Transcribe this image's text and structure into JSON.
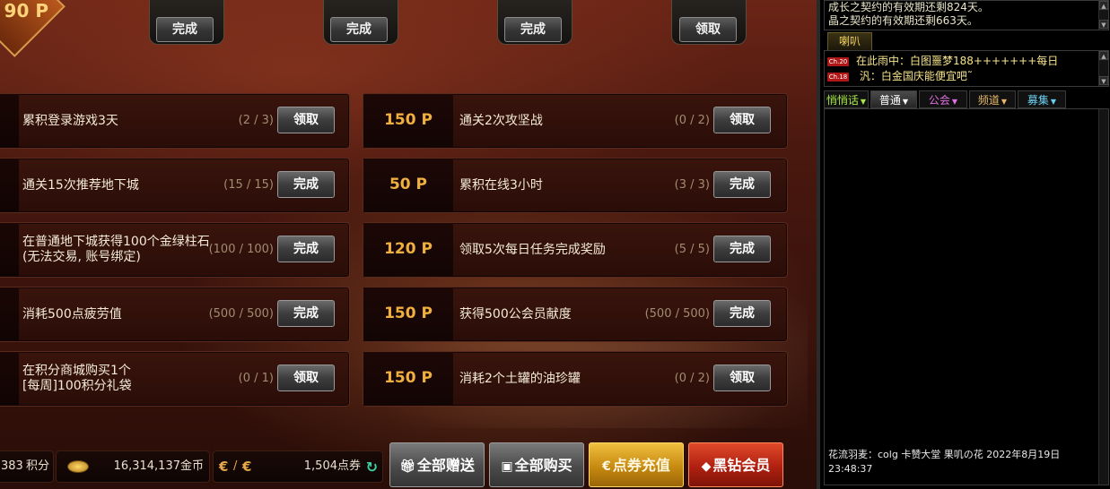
{
  "top": {
    "points_badge": "90 P",
    "slot_buttons": [
      "完成",
      "完成",
      "完成",
      "领取"
    ]
  },
  "left_tasks": [
    {
      "title": "累积登录游戏3天",
      "progress": "(2 / 3)",
      "button": "领取"
    },
    {
      "title": "通关15次推荐地下城",
      "progress": "(15 / 15)",
      "button": "完成"
    },
    {
      "title": "在普通地下城获得100个金绿柱石\n(无法交易, 账号绑定)",
      "progress": "(100 / 100)",
      "button": "完成"
    },
    {
      "title": "消耗500点疲劳值",
      "progress": "(500 / 500)",
      "button": "完成"
    },
    {
      "title": "在积分商城购买1个\n[每周]100积分礼袋",
      "progress": "(0 / 1)",
      "button": "领取"
    }
  ],
  "right_tasks": [
    {
      "points": "150 P",
      "title": "通关2次攻坚战",
      "progress": "(0 / 2)",
      "button": "领取"
    },
    {
      "points": "50 P",
      "title": "累积在线3小时",
      "progress": "(3 / 3)",
      "button": "完成"
    },
    {
      "points": "120 P",
      "title": "领取5次每日任务完成奖励",
      "progress": "(5 / 5)",
      "button": "完成"
    },
    {
      "points": "150 P",
      "title": "获得500公会员献度",
      "progress": "(500 / 500)",
      "button": "完成"
    },
    {
      "points": "150 P",
      "title": "消耗2个土罐的油珍罐",
      "progress": "(0 / 2)",
      "button": "领取"
    }
  ],
  "bottom": {
    "points_value": "383",
    "points_label": "积分",
    "gold_value": "16,314,137金币",
    "currency_sep": "/",
    "coupons_value": "1,504点券",
    "buttons": {
      "gift_all": "全部赠送",
      "buy_all": "全部购买",
      "recharge": "点券充值",
      "black_diamond": "黑钻会员"
    }
  },
  "chat": {
    "system_lines": [
      "成长之契约的有效期还剩824天。",
      "晶之契约的有效期还剩663天。"
    ],
    "speaker_tab": "喇叭",
    "speaker_lines": [
      {
        "badge": "Ch.20",
        "text": "在此雨中：白图噩梦188+++++++每日"
      },
      {
        "badge": "Ch.18",
        "text": "  汎：白金国庆能便宜吧˜"
      }
    ],
    "tabs": [
      {
        "label": "悄悄话",
        "color": "#a8e84a"
      },
      {
        "label": "普通",
        "color": "#ffffff"
      },
      {
        "label": "公会",
        "color": "#e070e0"
      },
      {
        "label": "频道",
        "color": "#e8b868"
      },
      {
        "label": "募集",
        "color": "#6ad0f0"
      }
    ],
    "message": "花流羽麦：colg 卡赞大堂 果叽の花 2022年8月19日23:48:37"
  }
}
